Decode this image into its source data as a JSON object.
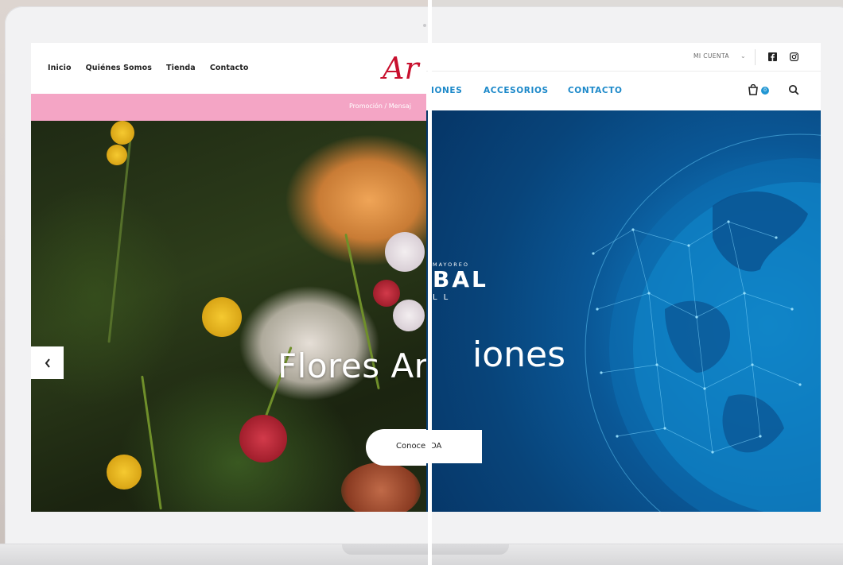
{
  "left_site": {
    "nav": [
      "Inicio",
      "Quiénes Somos",
      "Tienda",
      "Contacto"
    ],
    "logo_text": "Ar",
    "promo_text": "Promoción / Mensaj",
    "hero_title": "Flores Ar",
    "cta_label": "Conoce",
    "prev_arrow": "‹"
  },
  "right_site": {
    "account_label": "MI CUENTA",
    "account_chevron": "⌄",
    "nav": [
      {
        "label": "IONES"
      },
      {
        "label": "ACCESORIOS"
      },
      {
        "label": "CONTACTO"
      }
    ],
    "cart_count": "0",
    "brand_tag": "MAYOREO",
    "brand_name": "BAL",
    "brand_sub": "LL",
    "hero_title": "iones",
    "cta_label": "IDA"
  },
  "colors": {
    "left_promo": "#f4a5c5",
    "left_logo": "#c8102e",
    "right_accent": "#1b88c9",
    "right_hero": "#0a5796"
  }
}
